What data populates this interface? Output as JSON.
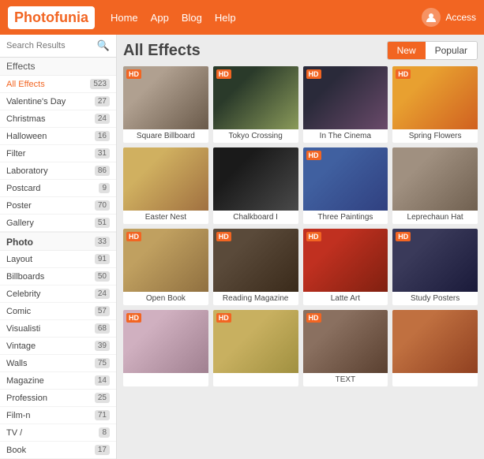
{
  "header": {
    "logo": "Photofunia",
    "nav": [
      "Home",
      "App",
      "Blog",
      "Help"
    ],
    "access_label": "Access"
  },
  "sidebar": {
    "search_placeholder": "Search Results",
    "section_effects": "Effects",
    "items_effects": [
      {
        "label": "All Effects",
        "count": "523",
        "active": true
      },
      {
        "label": "Valentine's Day",
        "count": "27"
      },
      {
        "label": "Christmas",
        "count": "24"
      },
      {
        "label": "Halloween",
        "count": "16"
      },
      {
        "label": "Filter",
        "count": "31"
      },
      {
        "label": "Laboratory",
        "count": "86"
      },
      {
        "label": "Postcard",
        "count": "9"
      },
      {
        "label": "Poster",
        "count": "70"
      },
      {
        "label": "Gallery",
        "count": "51"
      }
    ],
    "section_photo": "Photo",
    "photo_count": "33",
    "items_photo": [
      {
        "label": "Layout",
        "count": "91"
      },
      {
        "label": "Billboards",
        "count": "50"
      },
      {
        "label": "Celebrity",
        "count": "24"
      },
      {
        "label": "Comic",
        "count": "57"
      },
      {
        "label": "Visualisti",
        "count": "68"
      },
      {
        "label": "Vintage",
        "count": "39"
      },
      {
        "label": "Walls",
        "count": "75"
      },
      {
        "label": "Magazine",
        "count": "14"
      },
      {
        "label": "Profession",
        "count": "25"
      },
      {
        "label": "Film-n",
        "count": "71"
      },
      {
        "label": "TV /",
        "count": "8"
      },
      {
        "label": "Book",
        "count": "17"
      }
    ]
  },
  "content": {
    "title": "All Effects",
    "tabs": [
      "New",
      "Popular"
    ],
    "active_tab": "New",
    "effects": [
      {
        "name": "Square Billboard",
        "hd": true,
        "thumb": "thumb-1"
      },
      {
        "name": "Tokyo Crossing",
        "hd": true,
        "thumb": "thumb-2"
      },
      {
        "name": "In The Cinema",
        "hd": true,
        "thumb": "thumb-3"
      },
      {
        "name": "Spring Flowers",
        "hd": true,
        "thumb": "thumb-4"
      },
      {
        "name": "Easter Nest",
        "hd": false,
        "thumb": "thumb-5"
      },
      {
        "name": "Chalkboard I",
        "hd": false,
        "thumb": "thumb-6"
      },
      {
        "name": "Three Paintings",
        "hd": true,
        "thumb": "thumb-7"
      },
      {
        "name": "Leprechaun Hat",
        "hd": false,
        "thumb": "thumb-8"
      },
      {
        "name": "Open Book",
        "hd": true,
        "thumb": "thumb-9"
      },
      {
        "name": "Reading Magazine",
        "hd": true,
        "thumb": "thumb-10"
      },
      {
        "name": "Latte Art",
        "hd": true,
        "thumb": "thumb-11"
      },
      {
        "name": "Study Posters",
        "hd": true,
        "thumb": "thumb-12"
      },
      {
        "name": "",
        "hd": true,
        "thumb": "thumb-13"
      },
      {
        "name": "",
        "hd": true,
        "thumb": "thumb-14"
      },
      {
        "name": "TEXT",
        "hd": true,
        "thumb": "thumb-15"
      },
      {
        "name": "",
        "hd": false,
        "thumb": "thumb-16"
      }
    ]
  }
}
